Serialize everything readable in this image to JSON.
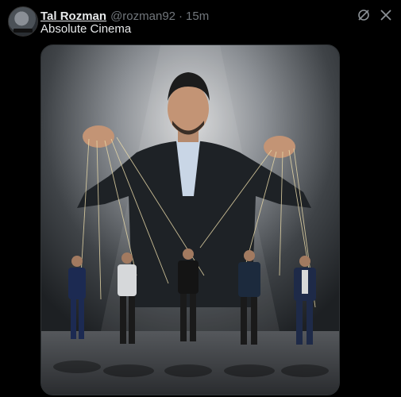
{
  "tweet": {
    "author_name": "Tal Rozman",
    "author_handle": "@rozman92",
    "separator": "·",
    "timestamp": "15m",
    "text": "Absolute Cinema"
  },
  "icons": {
    "grok": "grok-icon",
    "more": "more-icon"
  },
  "media": {
    "type": "image",
    "subject": "puppeteer-illustration"
  },
  "colors": {
    "background": "#000000",
    "text": "#e7e9ea",
    "muted": "#71767b"
  }
}
